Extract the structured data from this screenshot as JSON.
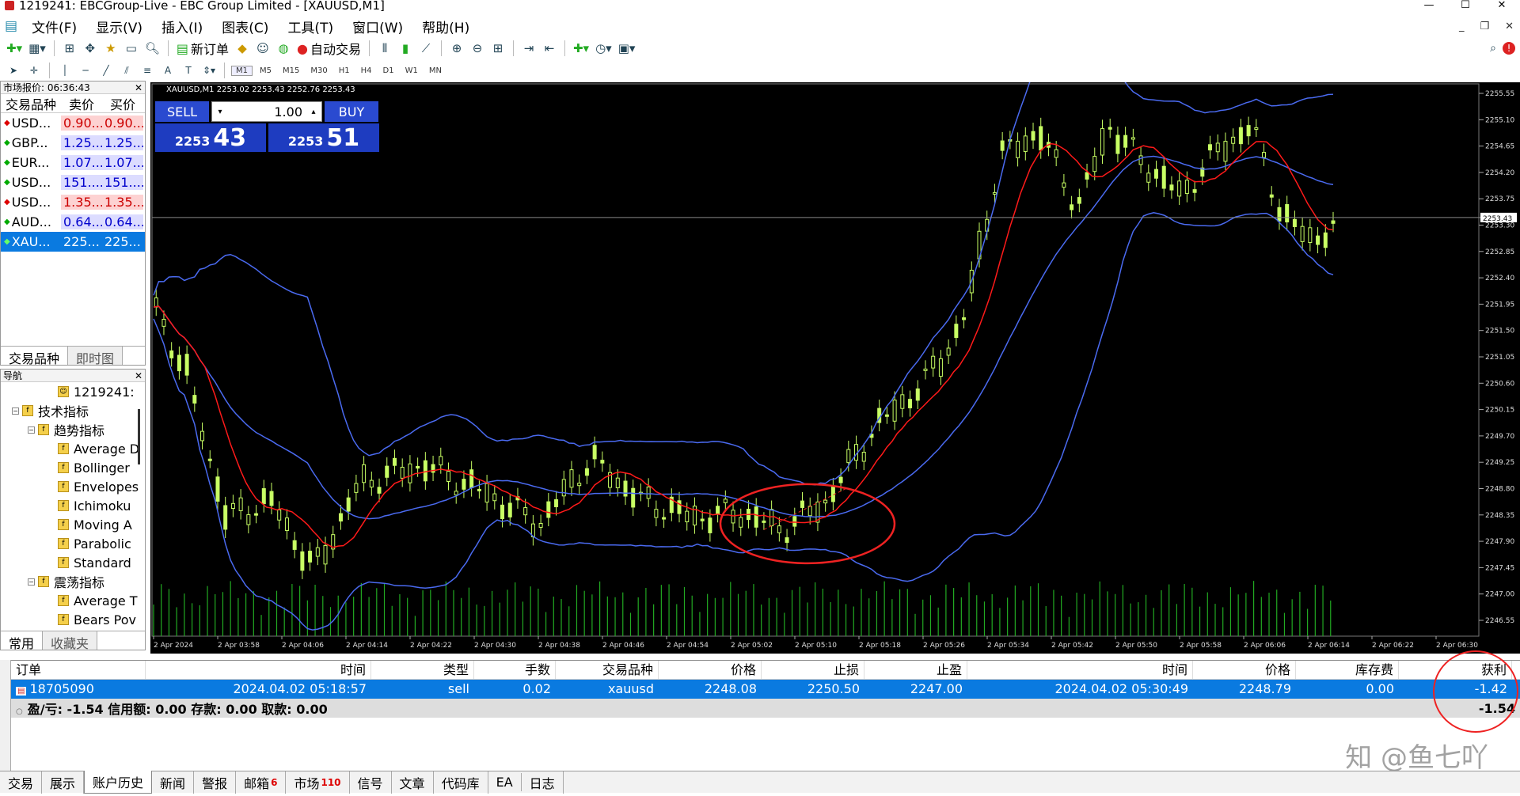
{
  "window": {
    "title": "1219241: EBCGroup-Live - EBC Group Limited - [XAUUSD,M1]"
  },
  "menu": [
    "文件(F)",
    "显示(V)",
    "插入(I)",
    "图表(C)",
    "工具(T)",
    "窗口(W)",
    "帮助(H)"
  ],
  "toolbar": {
    "new_order": "新订单",
    "auto_trade": "自动交易"
  },
  "timeframes": [
    "M1",
    "M5",
    "M15",
    "M30",
    "H1",
    "H4",
    "D1",
    "W1",
    "MN"
  ],
  "market_watch": {
    "title": "市场报价: 06:36:43",
    "cols": [
      "交易品种",
      "卖价",
      "买价"
    ],
    "rows": [
      {
        "sym": "USD...",
        "bid": "0.90...",
        "ask": "0.90..."
      },
      {
        "sym": "GBP...",
        "bid": "1.25...",
        "ask": "1.25..."
      },
      {
        "sym": "EUR...",
        "bid": "1.07...",
        "ask": "1.07..."
      },
      {
        "sym": "USD...",
        "bid": "151....",
        "ask": "151...."
      },
      {
        "sym": "USD...",
        "bid": "1.35...",
        "ask": "1.35..."
      },
      {
        "sym": "AUD...",
        "bid": "0.64...",
        "ask": "0.64..."
      },
      {
        "sym": "XAU...",
        "bid": "225...",
        "ask": "225..."
      }
    ],
    "tabs": [
      "交易品种",
      "即时图"
    ]
  },
  "navigator": {
    "title": "导航",
    "account": "1219241:",
    "tech": "技术指标",
    "trend": "趋势指标",
    "trend_items": [
      "Average D",
      "Bollinger",
      "Envelopes",
      "Ichimoku",
      "Moving A",
      "Parabolic",
      "Standard"
    ],
    "osc": "震荡指标",
    "osc_items": [
      "Average T",
      "Bears Pov"
    ],
    "tabs": [
      "常用",
      "收藏夹"
    ]
  },
  "chart": {
    "title": "XAUUSD,M1 2253.02 2253.43 2252.76 2253.43",
    "sell": "SELL",
    "buy": "BUY",
    "lots": "1.00",
    "bid_small": "2253",
    "bid_big": "43",
    "ask_small": "2253",
    "ask_big": "51",
    "current_price": "2253.43",
    "price_labels": [
      "2255.55",
      "2255.10",
      "2254.65",
      "2254.20",
      "2253.75",
      "2253.30",
      "2252.85",
      "2252.40",
      "2251.95",
      "2251.50",
      "2251.05",
      "2250.60",
      "2250.15",
      "2249.70",
      "2249.25",
      "2248.80",
      "2248.35",
      "2247.90",
      "2247.45",
      "2247.00",
      "2246.55"
    ],
    "time_labels": [
      "2 Apr 2024",
      "2 Apr 03:58",
      "2 Apr 04:06",
      "2 Apr 04:14",
      "2 Apr 04:22",
      "2 Apr 04:30",
      "2 Apr 04:38",
      "2 Apr 04:46",
      "2 Apr 04:54",
      "2 Apr 05:02",
      "2 Apr 05:10",
      "2 Apr 05:18",
      "2 Apr 05:26",
      "2 Apr 05:34",
      "2 Apr 05:42",
      "2 Apr 05:50",
      "2 Apr 05:58",
      "2 Apr 06:06",
      "2 Apr 06:14",
      "2 Apr 06:22",
      "2 Apr 06:30"
    ]
  },
  "orders": {
    "headers": [
      "订单",
      "时间",
      "类型",
      "手数",
      "交易品种",
      "价格",
      "止损",
      "止盈",
      "时间",
      "价格",
      "库存费",
      "获利"
    ],
    "row": [
      "18705090",
      "2024.04.02 05:18:57",
      "sell",
      "0.02",
      "xauusd",
      "2248.08",
      "2250.50",
      "2247.00",
      "2024.04.02 05:30:49",
      "2248.79",
      "0.00",
      "-1.42"
    ],
    "summary": "盈/亏: -1.54  信用额: 0.00  存款: 0.00  取款: 0.00",
    "total": "-1.54"
  },
  "bottom_tabs": [
    "交易",
    "展示",
    "账户历史",
    "新闻",
    "警报",
    "邮箱",
    "市场",
    "信号",
    "文章",
    "代码库",
    "EA",
    "日志"
  ],
  "badges": {
    "mail": "6",
    "market": "110"
  },
  "watermark": "知 @鱼七吖",
  "colors": {
    "accent": "#0a7ae0",
    "bull": "#c8ff64",
    "band": "#4a6af0",
    "ma": "#ff1a1a"
  }
}
